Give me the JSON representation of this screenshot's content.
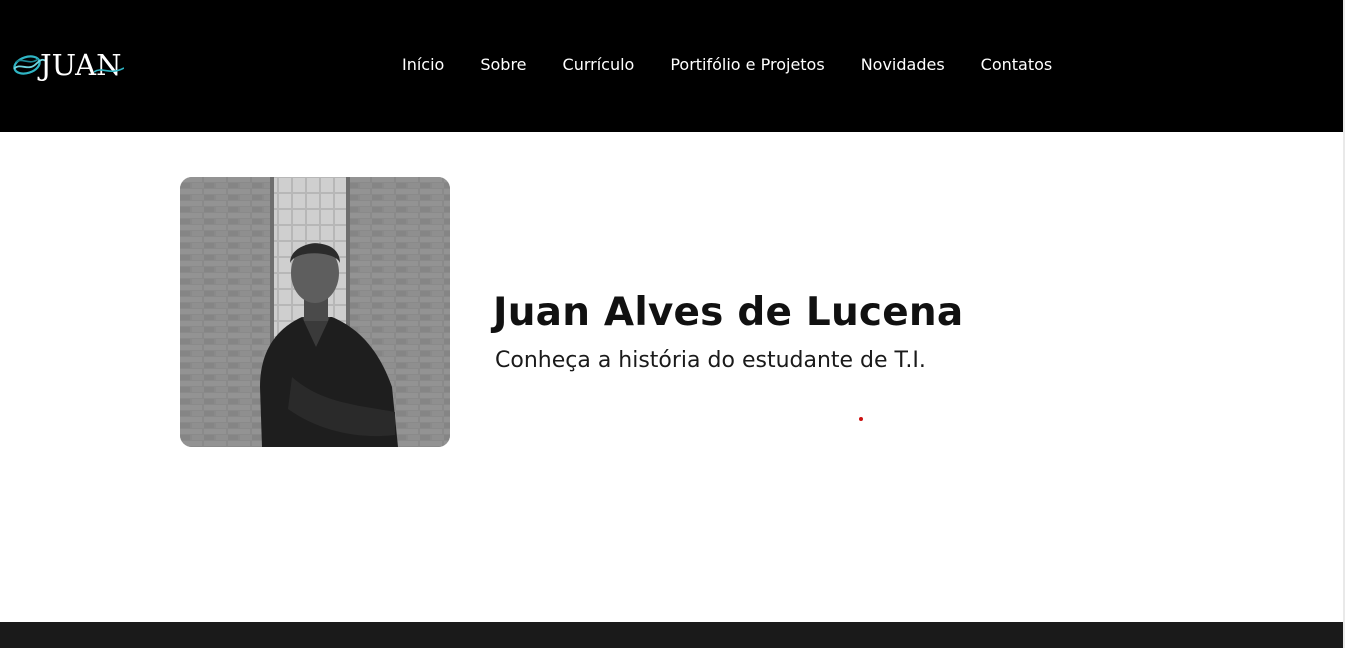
{
  "header": {
    "logo_text": "JUAN",
    "logo_icon": "wave-emblem-icon",
    "nav": [
      {
        "label": "Início"
      },
      {
        "label": "Sobre"
      },
      {
        "label": "Currículo"
      },
      {
        "label": "Portifólio e Projetos"
      },
      {
        "label": "Novidades"
      },
      {
        "label": "Contatos"
      }
    ]
  },
  "hero": {
    "photo_alt": "Foto de perfil em preto e branco",
    "name": "Juan Alves de Lucena",
    "subtitle": "Conheça a história do estudante de T.I."
  },
  "colors": {
    "header_bg": "#000000",
    "page_bg": "#ffffff",
    "footer_bg": "#1a1a1a",
    "logo_accent": "#2fb5c4",
    "dot": "#cc1111"
  }
}
